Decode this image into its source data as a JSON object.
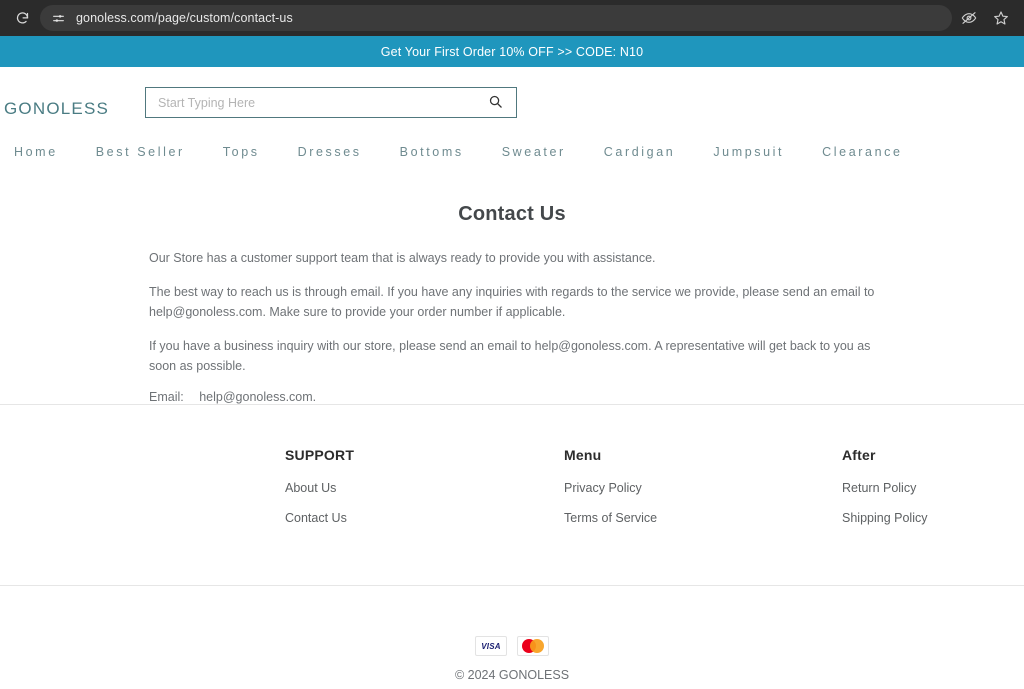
{
  "browser": {
    "reload_icon": "reload-icon",
    "site_settings_icon": "tune-sliders-icon",
    "url": "gonoless.com/page/custom/contact-us",
    "actions": [
      {
        "name": "hide-eye-icon",
        "icon": "eye-slash-icon"
      },
      {
        "name": "bookmark-icon",
        "icon": "star-icon"
      }
    ]
  },
  "promo": {
    "text": "Get Your First Order 10% OFF >> CODE: N10",
    "background": "#1f96bd",
    "color": "#ffffff"
  },
  "header": {
    "logo": "GONOLESS",
    "logo_color": "#4a7c83",
    "search": {
      "placeholder": "Start Typing Here",
      "value": "",
      "icon": "search-icon",
      "border_color": "#50787e"
    }
  },
  "nav": {
    "items": [
      {
        "label": "Home"
      },
      {
        "label": "Best Seller"
      },
      {
        "label": "Tops"
      },
      {
        "label": "Dresses"
      },
      {
        "label": "Bottoms"
      },
      {
        "label": "Sweater"
      },
      {
        "label": "Cardigan"
      },
      {
        "label": "Jumpsuit"
      },
      {
        "label": "Clearance"
      }
    ],
    "color": "#6f8b90"
  },
  "main": {
    "title": "Contact Us",
    "paragraphs": [
      "Our Store has a customer support team that is always ready to provide you with assistance.",
      "The best way to reach us is through email. If you have any inquiries with regards to the service we provide, please send an email to help@gonoless.com. Make sure to provide your order number if applicable.",
      "If you have a business inquiry with our store, please send an email to help@gonoless.com. A representative will get back to you as soon as possible."
    ],
    "email_label": "Email:",
    "email_value": "help@gonoless.com."
  },
  "footer": {
    "columns": [
      {
        "heading": "SUPPORT",
        "links": [
          {
            "label": "About Us"
          },
          {
            "label": "Contact Us"
          }
        ]
      },
      {
        "heading": "Menu",
        "links": [
          {
            "label": "Privacy Policy"
          },
          {
            "label": "Terms of Service"
          }
        ]
      },
      {
        "heading": "After",
        "links": [
          {
            "label": "Return Policy"
          },
          {
            "label": "Shipping Policy"
          }
        ]
      }
    ],
    "payments": [
      {
        "name": "visa-card-icon",
        "label": "VISA"
      },
      {
        "name": "mastercard-icon",
        "label": ""
      }
    ],
    "copyright": "© 2024 GONOLESS"
  }
}
